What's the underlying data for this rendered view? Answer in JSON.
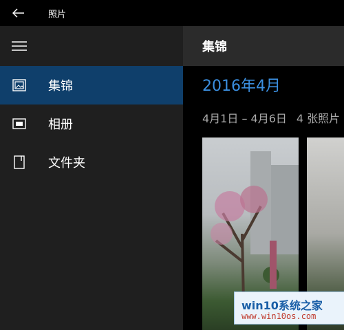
{
  "window": {
    "title": "照片"
  },
  "sidebar": {
    "items": [
      {
        "label": "集锦",
        "icon": "collection-icon",
        "active": true
      },
      {
        "label": "相册",
        "icon": "album-icon",
        "active": false
      },
      {
        "label": "文件夹",
        "icon": "folder-icon",
        "active": false
      }
    ]
  },
  "main": {
    "title": "集锦",
    "group": {
      "heading": "2016年4月",
      "range": "4月1日 – 4月6日",
      "count": "4 张照片"
    }
  },
  "watermark": {
    "line1": "win10系统之家",
    "line2": "www.win10os.com"
  },
  "colors": {
    "accent": "#3b8fe0",
    "active_nav": "#0f3f6b",
    "sidebar": "#1f1f1f"
  }
}
